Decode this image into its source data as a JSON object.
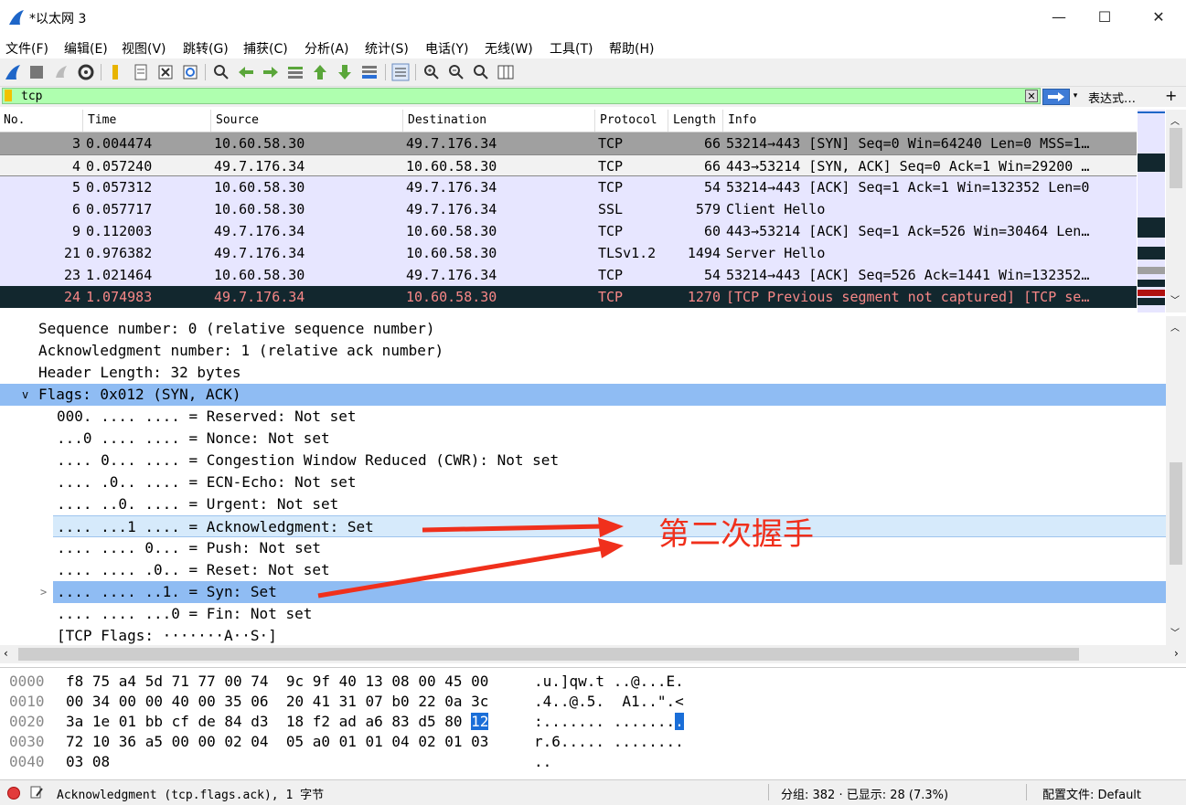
{
  "window": {
    "title": "*以太网 3",
    "minimize": "—",
    "maximize": "☐",
    "close": "✕"
  },
  "menu": [
    "文件(F)",
    "编辑(E)",
    "视图(V)",
    "跳转(G)",
    "捕获(C)",
    "分析(A)",
    "统计(S)",
    "电话(Y)",
    "无线(W)",
    "工具(T)",
    "帮助(H)"
  ],
  "toolbar_icons": [
    "shark-fin-icon",
    "stop-icon",
    "restart-icon",
    "options-gear-icon",
    "open-folder-icon",
    "file-icon",
    "close-file-icon",
    "reload-icon",
    "search-icon",
    "go-back-icon",
    "go-forward-icon",
    "go-to-packet-icon",
    "first-packet-icon",
    "last-packet-icon",
    "autoscroll-icon",
    "colorize-icon",
    "zoom-in-icon",
    "zoom-out-icon",
    "normal-size-icon",
    "resize-columns-icon"
  ],
  "filter": {
    "value": "tcp",
    "clear": "✕",
    "expression_label": "表达式…",
    "add": "+"
  },
  "packet_list": {
    "columns": [
      "No.",
      "Time",
      "Source",
      "Destination",
      "Protocol",
      "Length",
      "Info"
    ],
    "rows": [
      {
        "no": "3",
        "time": "0.004474",
        "src": "10.60.58.30",
        "dst": "49.7.176.34",
        "proto": "TCP",
        "len": "66",
        "info": "53214→443 [SYN] Seq=0 Win=64240 Len=0 MSS=1…"
      },
      {
        "no": "4",
        "time": "0.057240",
        "src": "49.7.176.34",
        "dst": "10.60.58.30",
        "proto": "TCP",
        "len": "66",
        "info": "443→53214 [SYN, ACK] Seq=0 Ack=1 Win=29200 …"
      },
      {
        "no": "5",
        "time": "0.057312",
        "src": "10.60.58.30",
        "dst": "49.7.176.34",
        "proto": "TCP",
        "len": "54",
        "info": "53214→443 [ACK] Seq=1 Ack=1 Win=132352 Len=0"
      },
      {
        "no": "6",
        "time": "0.057717",
        "src": "10.60.58.30",
        "dst": "49.7.176.34",
        "proto": "SSL",
        "len": "579",
        "info": "Client Hello"
      },
      {
        "no": "9",
        "time": "0.112003",
        "src": "49.7.176.34",
        "dst": "10.60.58.30",
        "proto": "TCP",
        "len": "60",
        "info": "443→53214 [ACK] Seq=1 Ack=526 Win=30464 Len…"
      },
      {
        "no": "21",
        "time": "0.976382",
        "src": "49.7.176.34",
        "dst": "10.60.58.30",
        "proto": "TLSv1.2",
        "len": "1494",
        "info": "Server Hello"
      },
      {
        "no": "23",
        "time": "1.021464",
        "src": "10.60.58.30",
        "dst": "49.7.176.34",
        "proto": "TCP",
        "len": "54",
        "info": "53214→443 [ACK] Seq=526 Ack=1441 Win=132352…"
      },
      {
        "no": "24",
        "time": "1.074983",
        "src": "49.7.176.34",
        "dst": "10.60.58.30",
        "proto": "TCP",
        "len": "1270",
        "info": "[TCP Previous segment not captured] [TCP se…"
      }
    ]
  },
  "detail": {
    "lines": [
      "Sequence number: 0    (relative sequence number)",
      "Acknowledgment number: 1    (relative ack number)",
      "Header Length: 32 bytes",
      "Flags: 0x012 (SYN, ACK)",
      "000. .... .... = Reserved: Not set",
      "...0 .... .... = Nonce: Not set",
      ".... 0... .... = Congestion Window Reduced (CWR): Not set",
      ".... .0.. .... = ECN-Echo: Not set",
      ".... ..0. .... = Urgent: Not set",
      ".... ...1 .... = Acknowledgment: Set",
      ".... .... 0... = Push: Not set",
      ".... .... .0.. = Reset: Not set",
      ".... .... ..1. = Syn: Set",
      ".... .... ...0 = Fin: Not set",
      "[TCP Flags: ·······A··S·]"
    ],
    "expand_open": "v",
    "expand_closed": ">",
    "annotation": "第二次握手"
  },
  "hex": {
    "rows": [
      {
        "off": "0000",
        "bytes": "f8 75 a4 5d 71 77 00 74  9c 9f 40 13 08 00 45 00",
        "ascii": ".u.]qw.t ..@...E."
      },
      {
        "off": "0010",
        "bytes": "00 34 00 00 40 00 35 06  20 41 31 07 b0 22 0a 3c",
        "ascii": ".4..@.5.  A1..\".<"
      },
      {
        "off": "0020",
        "bytes_pre": "3a 1e 01 bb cf de 84 d3  18 f2 ad a6 83 d5 80 ",
        "bytes_hl": "12",
        "ascii_pre": ":....... .......",
        "ascii_hl": "."
      },
      {
        "off": "0030",
        "bytes": "72 10 36 a5 00 00 02 04  05 a0 01 01 04 02 01 03",
        "ascii": "r.6..... ........"
      },
      {
        "off": "0040",
        "bytes": "03 08",
        "ascii": ".."
      }
    ]
  },
  "status": {
    "field": "Acknowledgment (tcp.flags.ack), 1 字节",
    "packets": "分组: 382 · 已显示: 28 (7.3%)",
    "profile": "配置文件: Default"
  },
  "colors": {
    "filter_bg": "#afffaf",
    "selected_row_bg": "#12272e",
    "selected_row_fg": "#f78787",
    "tcp_row_bg": "#e7e6ff",
    "detail_highlight": "#8fbcf3",
    "annotation": "#f0301c"
  }
}
